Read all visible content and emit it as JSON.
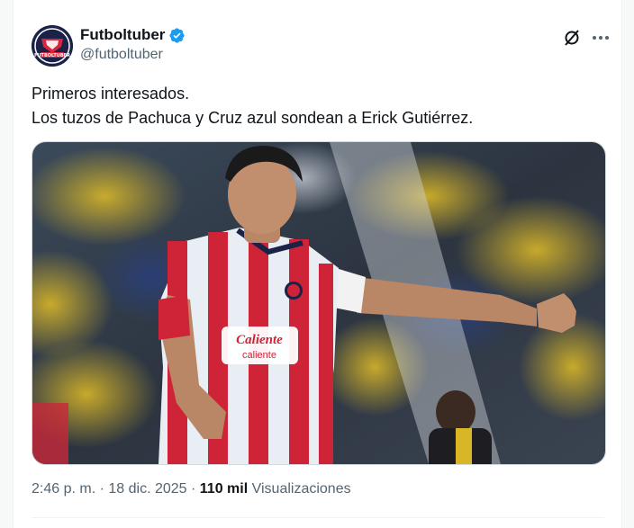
{
  "author": {
    "display_name": "Futboltuber",
    "handle": "@futboltuber",
    "avatar_icon": "futboltuber-logo-icon",
    "verified_icon": "verified-badge-icon",
    "verified_color": "#1d9bf0",
    "avatar_text": "FUTBOLTUBER"
  },
  "actions": {
    "grok_icon": "grok-icon",
    "more_icon": "more-horizontal-icon"
  },
  "tweet": {
    "lines": [
      "Primeros interesados.",
      "Los tuzos de Pachuca y Cruz azul sondean a Erick Gutiérrez."
    ]
  },
  "media": {
    "kind": "photo",
    "jersey_text": [
      "Caliente",
      "caliente"
    ]
  },
  "meta": {
    "time": "2:46 p. m.",
    "separator": " · ",
    "date": "18 dic. 2025",
    "views_count": "110 mil",
    "views_label": " Visualizaciones"
  },
  "colors": {
    "text_primary": "#0f1419",
    "text_secondary": "#536471",
    "border": "#cfd9de"
  }
}
